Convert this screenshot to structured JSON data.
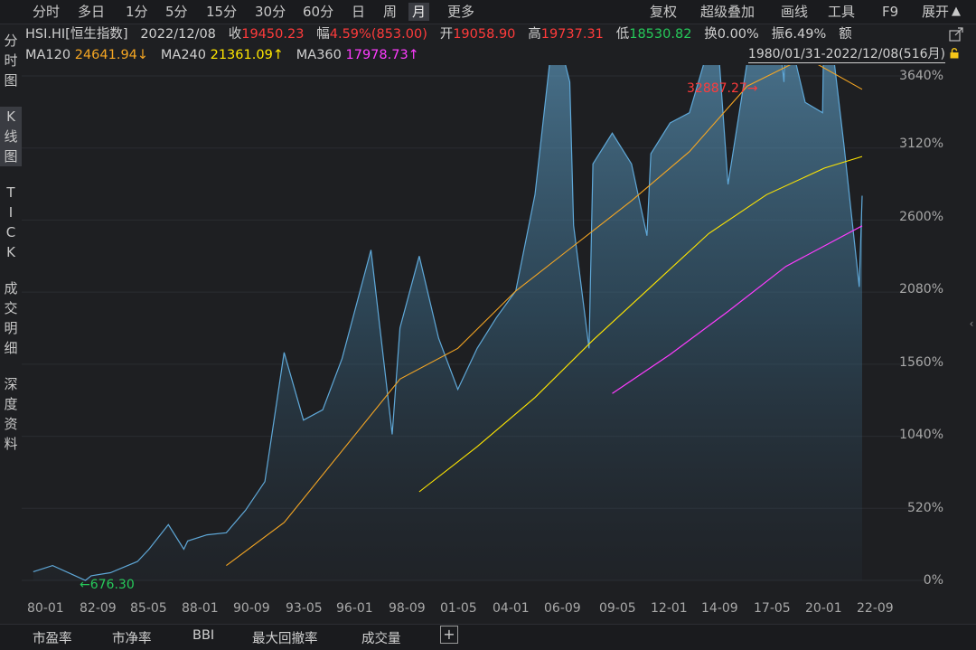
{
  "toolbar": {
    "periods": [
      "分时",
      "多日",
      "1分",
      "5分",
      "15分",
      "30分",
      "60分",
      "日",
      "周",
      "月",
      "更多"
    ],
    "active_period": "月",
    "right_items": [
      "复权",
      "超级叠加",
      "画线",
      "工具",
      "F9",
      "展开"
    ]
  },
  "quote": {
    "symbol": "HSI.HI[恒生指数]",
    "date": "2022/12/08",
    "close_label": "收",
    "close": "19450.23",
    "change_label": "幅",
    "change": "4.59%(853.00)",
    "open_label": "开",
    "open": "19058.90",
    "high_label": "高",
    "high": "19737.31",
    "low_label": "低",
    "low": "18530.82",
    "turnover_label": "换",
    "turnover": "0.00%",
    "amplitude_label": "振",
    "amplitude": "6.49%",
    "amount_label": "额"
  },
  "ma": {
    "ma120_label": "MA120",
    "ma120": "24641.94↓",
    "ma240_label": "MA240",
    "ma240": "21361.09↑",
    "ma360_label": "MA360",
    "ma360": "17978.73↑"
  },
  "range": "1980/01/31-2022/12/08(516月)",
  "sidebar": {
    "groups": [
      {
        "chars": [
          "分",
          "时",
          "图"
        ]
      },
      {
        "chars": [
          "K",
          "线",
          "图"
        ]
      },
      {
        "chars": [
          "T",
          "I",
          "C",
          "K"
        ]
      },
      {
        "chars": [
          "成",
          "交",
          "明",
          "细"
        ]
      },
      {
        "chars": [
          "深",
          "度",
          "资",
          "料"
        ]
      }
    ]
  },
  "annotations": {
    "max": "32887.27",
    "min": "676.30"
  },
  "bottom": {
    "items": [
      "市盈率",
      "市净率",
      "BBI",
      "最大回撤率",
      "成交量"
    ],
    "plus": "+"
  },
  "colors": {
    "price": "#5fa8d8",
    "ma120": "#f5a623",
    "ma240": "#ffe600",
    "ma360": "#ff3cff",
    "up": "#ff3b3b",
    "down": "#26c95a"
  },
  "chart_data": {
    "type": "area",
    "x_ticks": [
      "80-01",
      "82-09",
      "85-05",
      "88-01",
      "90-09",
      "93-05",
      "96-01",
      "98-09",
      "01-05",
      "04-01",
      "06-09",
      "09-05",
      "12-01",
      "14-09",
      "17-05",
      "20-01",
      "22-09"
    ],
    "y_ticks": [
      "3640%",
      "3120%",
      "2600%",
      "2080%",
      "1560%",
      "1040%",
      "520%",
      "0%"
    ],
    "ylim_pct": [
      0,
      3640
    ],
    "series": [
      {
        "name": "HSI",
        "x": [
          1980,
          1981,
          1982.7,
          1983,
          1984,
          1985.4,
          1986,
          1987,
          1987.8,
          1988,
          1989,
          1990,
          1991,
          1992,
          1993,
          1994,
          1995,
          1996,
          1997.5,
          1998.6,
          1999,
          2000,
          2001,
          2002,
          2003,
          2004,
          2005,
          2006,
          2007,
          2007.8,
          2008,
          2008.8,
          2009,
          2010,
          2011,
          2011.8,
          2012,
          2013,
          2014,
          2015.4,
          2016,
          2017,
          2018,
          2018.9,
          2019,
          2020,
          2020.9,
          2021,
          2022,
          2022.8,
          2022.95
        ],
        "y": [
          1100,
          1400,
          676,
          900,
          1050,
          1600,
          2200,
          3400,
          2200,
          2600,
          2900,
          3000,
          4100,
          5500,
          11800,
          8500,
          9000,
          11500,
          16800,
          7800,
          13000,
          16500,
          12500,
          10000,
          12000,
          13500,
          14800,
          19500,
          28000,
          25000,
          18000,
          12000,
          21000,
          22500,
          21000,
          17500,
          21500,
          23000,
          23500,
          28000,
          20000,
          26000,
          33000,
          25000,
          28000,
          24000,
          23500,
          30000,
          22000,
          15000,
          19450
        ]
      },
      {
        "name": "MA120",
        "x": [
          1990,
          1993,
          1996,
          1999,
          2002,
          2005,
          2008,
          2011,
          2014,
          2017,
          2020,
          2022.95
        ],
        "y": [
          1400,
          3500,
          7000,
          10500,
          12000,
          14800,
          17000,
          19200,
          21600,
          24800,
          26200,
          24642
        ]
      },
      {
        "name": "MA240",
        "x": [
          2000,
          2003,
          2006,
          2009,
          2012,
          2015,
          2018,
          2021,
          2022.95
        ],
        "y": [
          5000,
          7200,
          9600,
          12400,
          15000,
          17600,
          19500,
          20800,
          21361
        ]
      },
      {
        "name": "MA360",
        "x": [
          2010,
          2013,
          2016,
          2019,
          2022.95
        ],
        "y": [
          9800,
          11700,
          13800,
          16000,
          17979
        ]
      }
    ],
    "max_label": "32887.27",
    "min_label": "676.30"
  }
}
